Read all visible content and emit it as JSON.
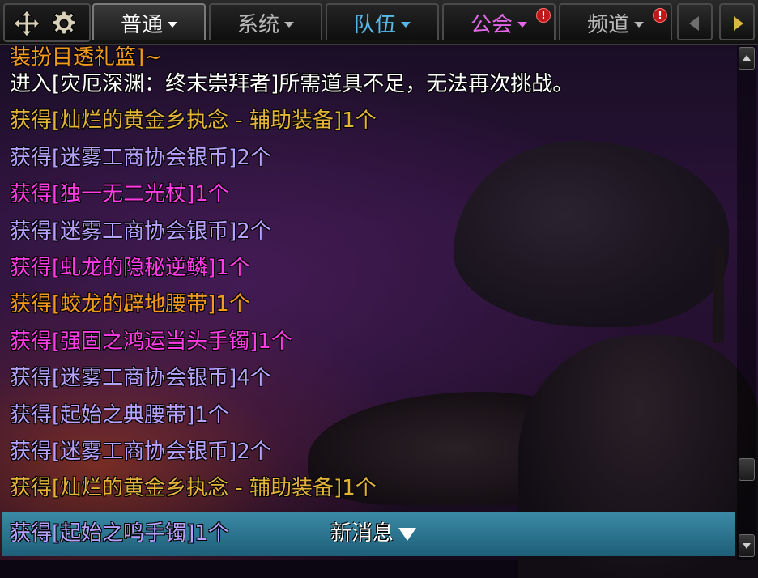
{
  "tabs": [
    {
      "label": "普通",
      "active": true,
      "alert": false
    },
    {
      "label": "系统",
      "active": false,
      "alert": false
    },
    {
      "label": "队伍",
      "active": false,
      "alert": false,
      "color": "#57b8e8"
    },
    {
      "label": "公会",
      "active": false,
      "alert": true,
      "color": "#e468e8"
    },
    {
      "label": "频道",
      "active": false,
      "alert": true
    }
  ],
  "alert_mark": "!",
  "icons": [
    "move-icon",
    "gear-icon",
    "tab-scroll-left-icon",
    "tab-scroll-right-icon",
    "scroll-up-icon",
    "scroll-down-icon",
    "new-message-down-icon"
  ],
  "chat": {
    "partial_line": {
      "text": "装扮目透礼篮]~",
      "color": "orange"
    },
    "lines": [
      {
        "text": "进入[灾厄深渊：终末崇拜者]所需道具不足，无法再次挑战。",
        "color": "white"
      },
      {
        "text": "获得[灿烂的黄金乡执念 - 辅助装备]1个",
        "color": "gold"
      },
      {
        "text": "获得[迷雾工商协会银币]2个",
        "color": "purple"
      },
      {
        "text": "获得[独一无二光杖]1个",
        "color": "magenta"
      },
      {
        "text": "获得[迷雾工商协会银币]2个",
        "color": "purple"
      },
      {
        "text": "获得[虬龙的隐秘逆鳞]1个",
        "color": "magenta"
      },
      {
        "text": "获得[蛟龙的辟地腰带]1个",
        "color": "orange"
      },
      {
        "text": "获得[强固之鸿运当头手镯]1个",
        "color": "magenta"
      },
      {
        "text": "获得[迷雾工商协会银币]4个",
        "color": "purple"
      },
      {
        "text": "获得[起始之典腰带]1个",
        "color": "purple"
      },
      {
        "text": "获得[迷雾工商协会银币]2个",
        "color": "purple"
      },
      {
        "text": "获得[灿烂的黄金乡执念 - 辅助装备]1个",
        "color": "gold"
      }
    ],
    "last_line": {
      "text": "获得[起始之鸣手镯]1个",
      "color": "purple"
    },
    "new_message_label": "新消息"
  },
  "colors": {
    "white": "#ffffff",
    "orange": "#f29a1e",
    "gold": "#e2b43a",
    "purple": "#b8a2ff",
    "magenta": "#ff3ce6",
    "highlight_bar": "#2f7a96"
  }
}
